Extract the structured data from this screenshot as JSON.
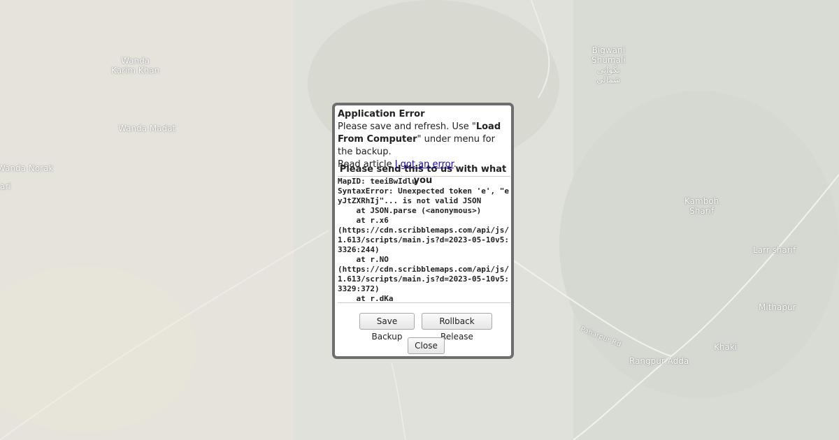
{
  "map": {
    "labels": [
      {
        "key": "wanda-karim-khan",
        "text": "Wanda\nKarim Khan"
      },
      {
        "key": "wanda-madat",
        "text": "Wanda Madat"
      },
      {
        "key": "wanda-norak",
        "text": "Wanda Norak"
      },
      {
        "key": "ari",
        "text": "ari"
      },
      {
        "key": "bigwani-shumali",
        "text": "Bigwani\nShumali\nبگوانی\nشمالی"
      },
      {
        "key": "kamboh-sharif",
        "text": "Kamboh\nSharif"
      },
      {
        "key": "larr-sharif",
        "text": "Larr sharif"
      },
      {
        "key": "mithapur",
        "text": "Mithapur"
      },
      {
        "key": "khaki",
        "text": "Khaki"
      },
      {
        "key": "rangpur-adda",
        "text": "Rangpur Adda"
      },
      {
        "key": "paharpur-rd",
        "text": "Paharpur Rd"
      }
    ]
  },
  "dialog": {
    "title": "Application Error",
    "message_prefix": "Please save and refresh. Use \"",
    "message_bold": "Load From Computer",
    "message_suffix": "\" under menu for the backup.",
    "read_article_prefix": "Read article ",
    "read_article_link": "I got an error",
    "read_article_suffix": ".",
    "send_label": "Please send this to us with what you",
    "error_log": "MapID: teeiBwIdlu\nSyntaxError: Unexpected token 'e', \"eyJtZXRhIj\"... is not valid JSON\n    at JSON.parse (<anonymous>)\n    at r.x6\n(https://cdn.scribblemaps.com/api/js/1.613/scripts/main.js?d=2023-05-10v5:3326:244)\n    at r.NO\n(https://cdn.scribblemaps.com/api/js/1.613/scripts/main.js?d=2023-05-10v5:3329:372)\n    at r.dKa",
    "save_backup_label": "Save Backup",
    "rollback_label": "Rollback Release",
    "close_label": "Close"
  }
}
